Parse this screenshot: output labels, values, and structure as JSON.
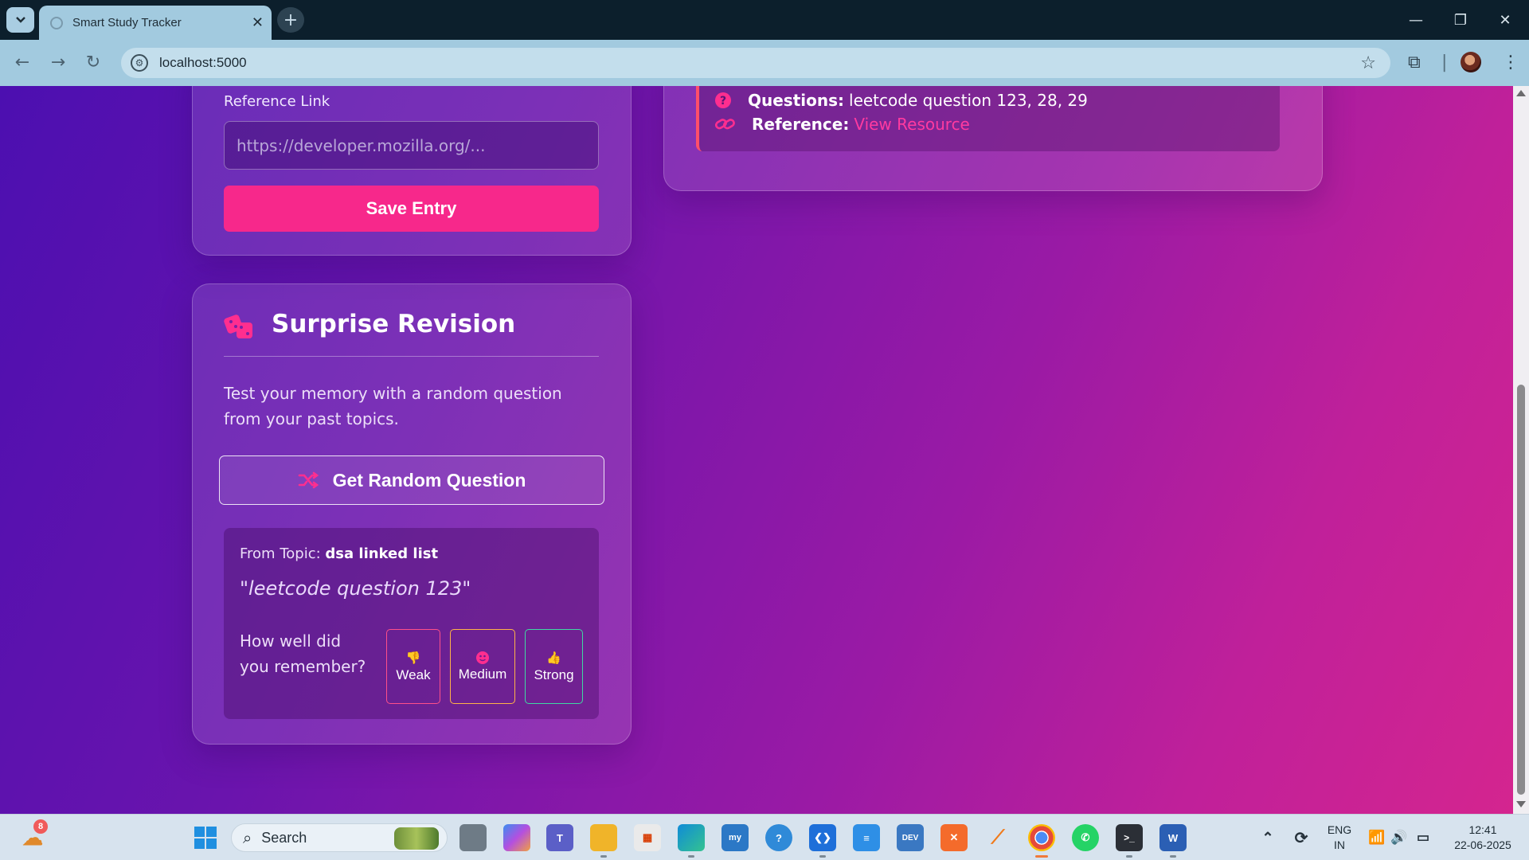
{
  "browser": {
    "tab_title": "Smart Study Tracker",
    "url": "localhost:5000"
  },
  "entry_form": {
    "reference_label": "Reference Link",
    "reference_placeholder": "https://developer.mozilla.org/...",
    "save_label": "Save Entry"
  },
  "entry_preview": {
    "questions_label": "Questions:",
    "questions_value": "leetcode question 123, 28, 29",
    "reference_label": "Reference:",
    "reference_link_text": "View Resource"
  },
  "surprise_revision": {
    "title": "Surprise Revision",
    "description": "Test your memory with a random question from your past topics.",
    "button_label": "Get Random Question",
    "from_topic_label": "From Topic:",
    "topic_name": "dsa linked list",
    "question": "\"leetcode question 123\"",
    "rate_prompt": "How well did you remember?",
    "rate_buttons": {
      "weak": "Weak",
      "medium": "Medium",
      "strong": "Strong"
    }
  },
  "taskbar": {
    "weather_badge": "8",
    "search_label": "Search",
    "lang_line1": "ENG",
    "lang_line2": "IN",
    "time": "12:41",
    "date": "22-06-2025"
  },
  "colors": {
    "accent_pink": "#f7288b",
    "link_pink": "#ff3aa0",
    "weak_border": "#ff4f8a",
    "medium_border": "#ffb347",
    "strong_border": "#3fd9a3"
  }
}
